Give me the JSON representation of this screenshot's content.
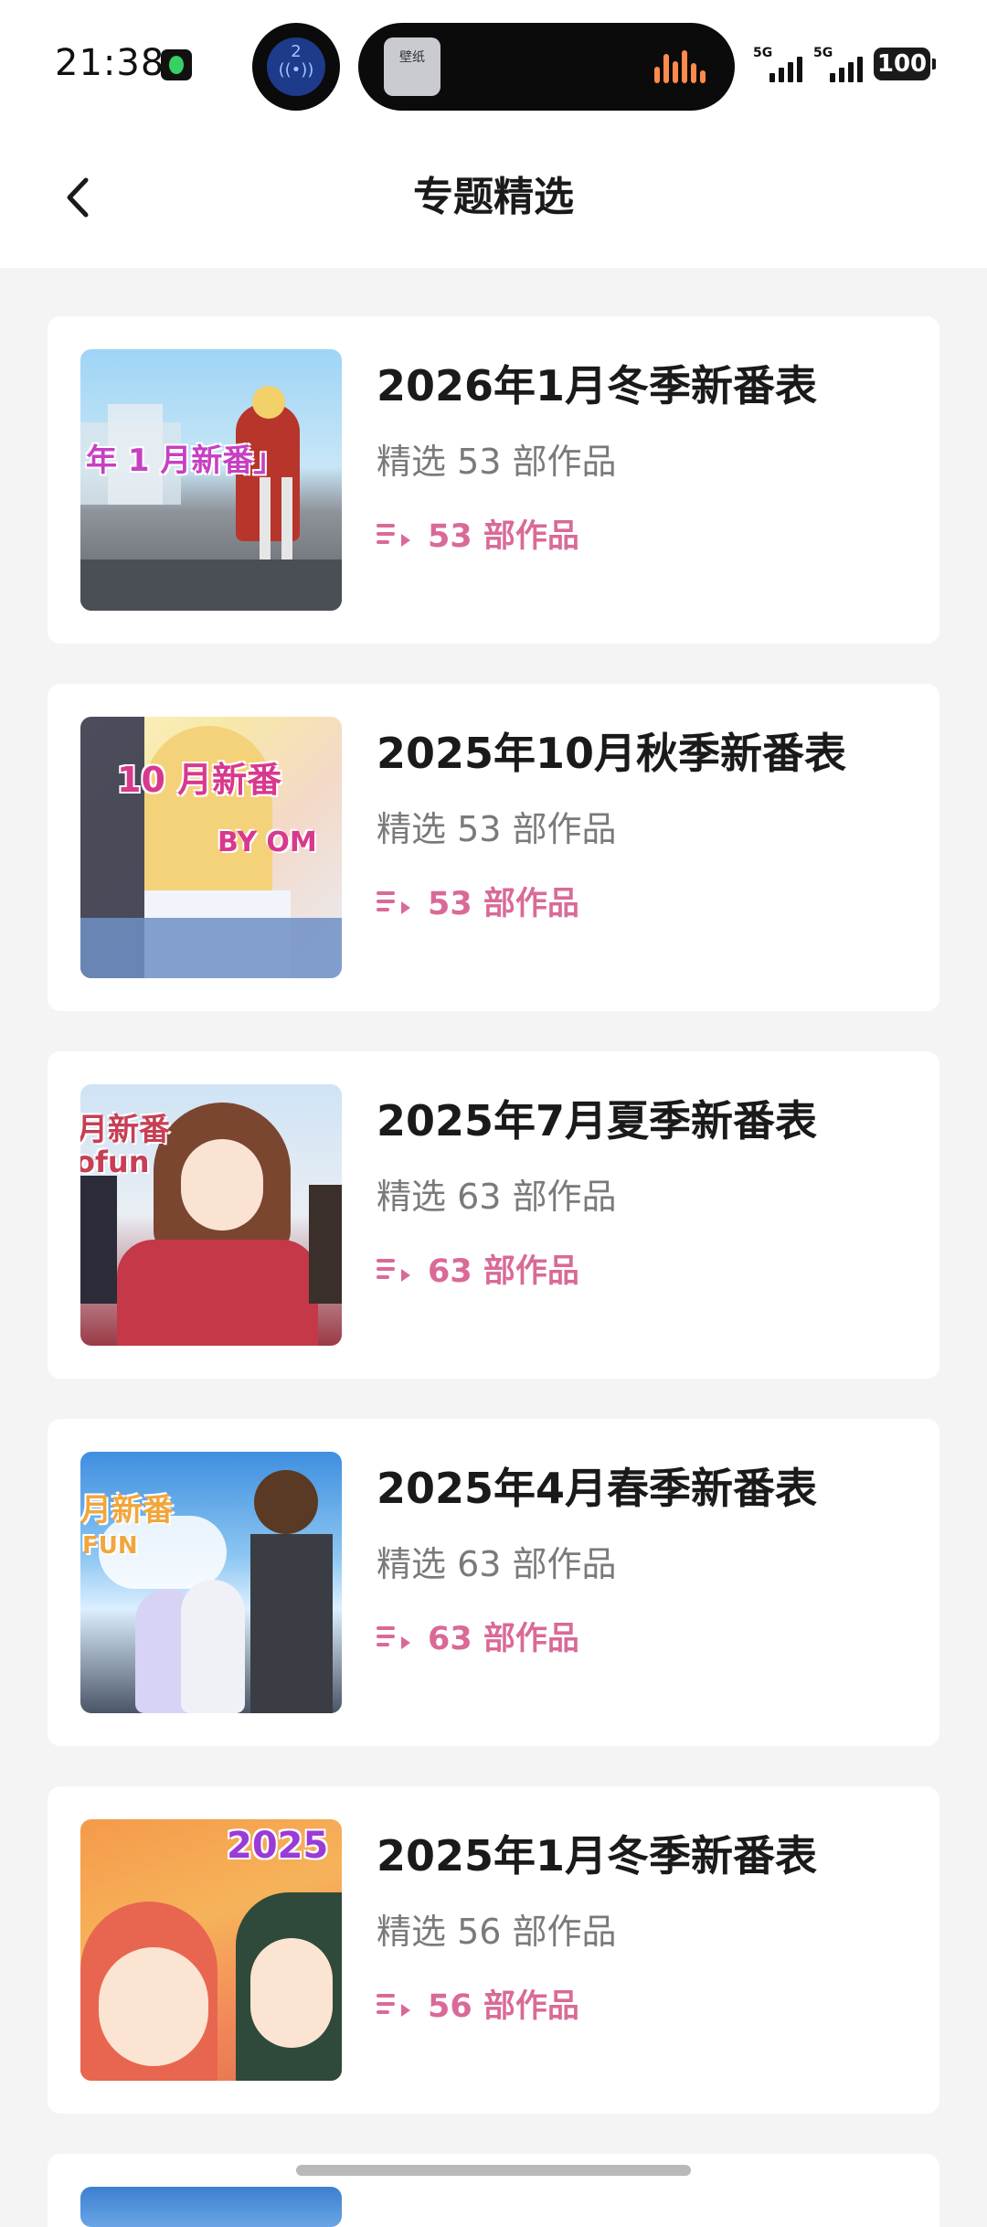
{
  "status_bar": {
    "time": "21:38",
    "island_badge": "2",
    "island_thumb_text": "壁纸",
    "signal_1": "5G",
    "signal_2": "5G",
    "battery": "100"
  },
  "header": {
    "title": "专题精选"
  },
  "collections": [
    {
      "title": "2026年1月冬季新番表",
      "subtitle": "精选 53 部作品",
      "count": "53 部作品",
      "cover_text": "年 1 月新番」"
    },
    {
      "title": "2025年10月秋季新番表",
      "subtitle": "精选 53 部作品",
      "count": "53 部作品",
      "cover_text": "10 月新番",
      "cover_text_2": "BY OM"
    },
    {
      "title": "2025年7月夏季新番表",
      "subtitle": "精选 63 部作品",
      "count": "63 部作品",
      "cover_text": "月新番",
      "cover_text_2": "ofun"
    },
    {
      "title": "2025年4月春季新番表",
      "subtitle": "精选 63 部作品",
      "count": "63 部作品",
      "cover_text": "月新番",
      "cover_text_2": "FUN"
    },
    {
      "title": "2025年1月冬季新番表",
      "subtitle": "精选 56 部作品",
      "count": "56 部作品",
      "cover_text": "2025"
    }
  ],
  "colors": {
    "accent": "#d96a98",
    "title": "#1a1a1a",
    "subtitle": "#7a7a7a",
    "background": "#f4f4f4"
  },
  "icons": {
    "back": "chevron-left-icon",
    "count": "playlist-icon"
  }
}
